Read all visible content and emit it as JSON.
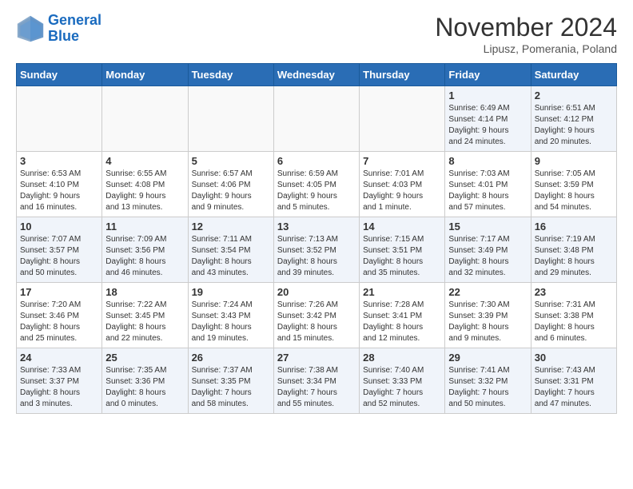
{
  "logo": {
    "line1": "General",
    "line2": "Blue"
  },
  "title": "November 2024",
  "location": "Lipusz, Pomerania, Poland",
  "days_of_week": [
    "Sunday",
    "Monday",
    "Tuesday",
    "Wednesday",
    "Thursday",
    "Friday",
    "Saturday"
  ],
  "weeks": [
    [
      {
        "day": "",
        "info": ""
      },
      {
        "day": "",
        "info": ""
      },
      {
        "day": "",
        "info": ""
      },
      {
        "day": "",
        "info": ""
      },
      {
        "day": "",
        "info": ""
      },
      {
        "day": "1",
        "info": "Sunrise: 6:49 AM\nSunset: 4:14 PM\nDaylight: 9 hours\nand 24 minutes."
      },
      {
        "day": "2",
        "info": "Sunrise: 6:51 AM\nSunset: 4:12 PM\nDaylight: 9 hours\nand 20 minutes."
      }
    ],
    [
      {
        "day": "3",
        "info": "Sunrise: 6:53 AM\nSunset: 4:10 PM\nDaylight: 9 hours\nand 16 minutes."
      },
      {
        "day": "4",
        "info": "Sunrise: 6:55 AM\nSunset: 4:08 PM\nDaylight: 9 hours\nand 13 minutes."
      },
      {
        "day": "5",
        "info": "Sunrise: 6:57 AM\nSunset: 4:06 PM\nDaylight: 9 hours\nand 9 minutes."
      },
      {
        "day": "6",
        "info": "Sunrise: 6:59 AM\nSunset: 4:05 PM\nDaylight: 9 hours\nand 5 minutes."
      },
      {
        "day": "7",
        "info": "Sunrise: 7:01 AM\nSunset: 4:03 PM\nDaylight: 9 hours\nand 1 minute."
      },
      {
        "day": "8",
        "info": "Sunrise: 7:03 AM\nSunset: 4:01 PM\nDaylight: 8 hours\nand 57 minutes."
      },
      {
        "day": "9",
        "info": "Sunrise: 7:05 AM\nSunset: 3:59 PM\nDaylight: 8 hours\nand 54 minutes."
      }
    ],
    [
      {
        "day": "10",
        "info": "Sunrise: 7:07 AM\nSunset: 3:57 PM\nDaylight: 8 hours\nand 50 minutes."
      },
      {
        "day": "11",
        "info": "Sunrise: 7:09 AM\nSunset: 3:56 PM\nDaylight: 8 hours\nand 46 minutes."
      },
      {
        "day": "12",
        "info": "Sunrise: 7:11 AM\nSunset: 3:54 PM\nDaylight: 8 hours\nand 43 minutes."
      },
      {
        "day": "13",
        "info": "Sunrise: 7:13 AM\nSunset: 3:52 PM\nDaylight: 8 hours\nand 39 minutes."
      },
      {
        "day": "14",
        "info": "Sunrise: 7:15 AM\nSunset: 3:51 PM\nDaylight: 8 hours\nand 35 minutes."
      },
      {
        "day": "15",
        "info": "Sunrise: 7:17 AM\nSunset: 3:49 PM\nDaylight: 8 hours\nand 32 minutes."
      },
      {
        "day": "16",
        "info": "Sunrise: 7:19 AM\nSunset: 3:48 PM\nDaylight: 8 hours\nand 29 minutes."
      }
    ],
    [
      {
        "day": "17",
        "info": "Sunrise: 7:20 AM\nSunset: 3:46 PM\nDaylight: 8 hours\nand 25 minutes."
      },
      {
        "day": "18",
        "info": "Sunrise: 7:22 AM\nSunset: 3:45 PM\nDaylight: 8 hours\nand 22 minutes."
      },
      {
        "day": "19",
        "info": "Sunrise: 7:24 AM\nSunset: 3:43 PM\nDaylight: 8 hours\nand 19 minutes."
      },
      {
        "day": "20",
        "info": "Sunrise: 7:26 AM\nSunset: 3:42 PM\nDaylight: 8 hours\nand 15 minutes."
      },
      {
        "day": "21",
        "info": "Sunrise: 7:28 AM\nSunset: 3:41 PM\nDaylight: 8 hours\nand 12 minutes."
      },
      {
        "day": "22",
        "info": "Sunrise: 7:30 AM\nSunset: 3:39 PM\nDaylight: 8 hours\nand 9 minutes."
      },
      {
        "day": "23",
        "info": "Sunrise: 7:31 AM\nSunset: 3:38 PM\nDaylight: 8 hours\nand 6 minutes."
      }
    ],
    [
      {
        "day": "24",
        "info": "Sunrise: 7:33 AM\nSunset: 3:37 PM\nDaylight: 8 hours\nand 3 minutes."
      },
      {
        "day": "25",
        "info": "Sunrise: 7:35 AM\nSunset: 3:36 PM\nDaylight: 8 hours\nand 0 minutes."
      },
      {
        "day": "26",
        "info": "Sunrise: 7:37 AM\nSunset: 3:35 PM\nDaylight: 7 hours\nand 58 minutes."
      },
      {
        "day": "27",
        "info": "Sunrise: 7:38 AM\nSunset: 3:34 PM\nDaylight: 7 hours\nand 55 minutes."
      },
      {
        "day": "28",
        "info": "Sunrise: 7:40 AM\nSunset: 3:33 PM\nDaylight: 7 hours\nand 52 minutes."
      },
      {
        "day": "29",
        "info": "Sunrise: 7:41 AM\nSunset: 3:32 PM\nDaylight: 7 hours\nand 50 minutes."
      },
      {
        "day": "30",
        "info": "Sunrise: 7:43 AM\nSunset: 3:31 PM\nDaylight: 7 hours\nand 47 minutes."
      }
    ]
  ]
}
